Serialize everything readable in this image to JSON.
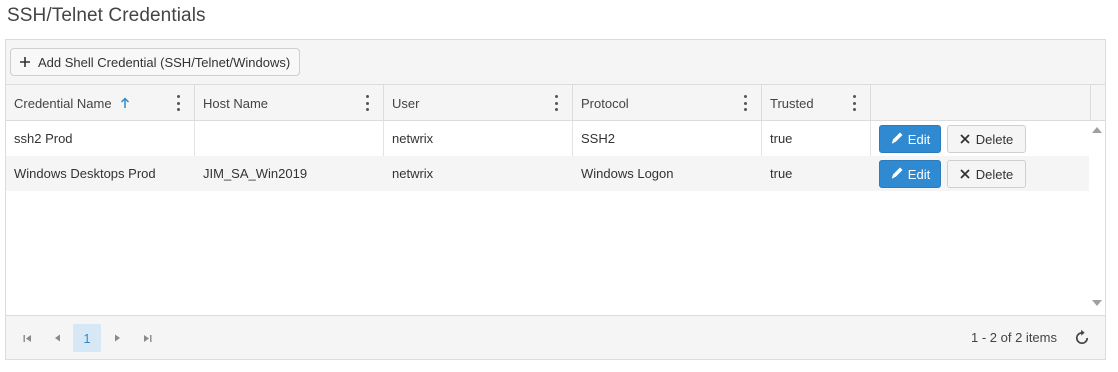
{
  "page": {
    "title": "SSH/Telnet Credentials"
  },
  "toolbar": {
    "add_label": "Add Shell Credential (SSH/Telnet/Windows)"
  },
  "columns": [
    {
      "label": "Credential Name",
      "sorted": "asc"
    },
    {
      "label": "Host Name"
    },
    {
      "label": "User"
    },
    {
      "label": "Protocol"
    },
    {
      "label": "Trusted"
    },
    {
      "label": ""
    }
  ],
  "rows": [
    {
      "name": "ssh2 Prod",
      "host": "",
      "user": "netwrix",
      "protocol": "SSH2",
      "trusted": "true"
    },
    {
      "name": "Windows Desktops Prod",
      "host": "JIM_SA_Win2019",
      "user": "netwrix",
      "protocol": "Windows Logon",
      "trusted": "true"
    }
  ],
  "actions": {
    "edit_label": "Edit",
    "delete_label": "Delete"
  },
  "pager": {
    "current_page": "1",
    "items_info": "1 - 2 of 2 items"
  },
  "colors": {
    "accent": "#2f8ad1",
    "header_bg": "#f5f5f5",
    "border": "#dcdcdc"
  }
}
